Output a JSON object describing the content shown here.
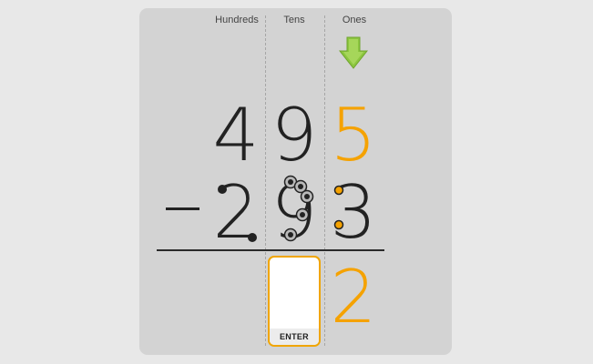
{
  "columns": {
    "hundreds": "Hundreds",
    "tens": "Tens",
    "ones": "Ones"
  },
  "problem": {
    "minuend": {
      "hundreds": "4",
      "tens": "9",
      "ones": "5"
    },
    "subtrahend": {
      "hundreds": "2",
      "tens": "9",
      "ones": "3"
    },
    "operator": "−",
    "result": {
      "tens": "",
      "ones": "2"
    }
  },
  "answer_input": {
    "value": "",
    "enter_label": "ENTER"
  },
  "indicator": {
    "icon": "arrow-down-icon",
    "active_column": "Ones"
  },
  "colors": {
    "highlight": "#f5a200",
    "arrow": "#8cc63f",
    "digit": "#222222",
    "card": "#d3d3d3"
  }
}
